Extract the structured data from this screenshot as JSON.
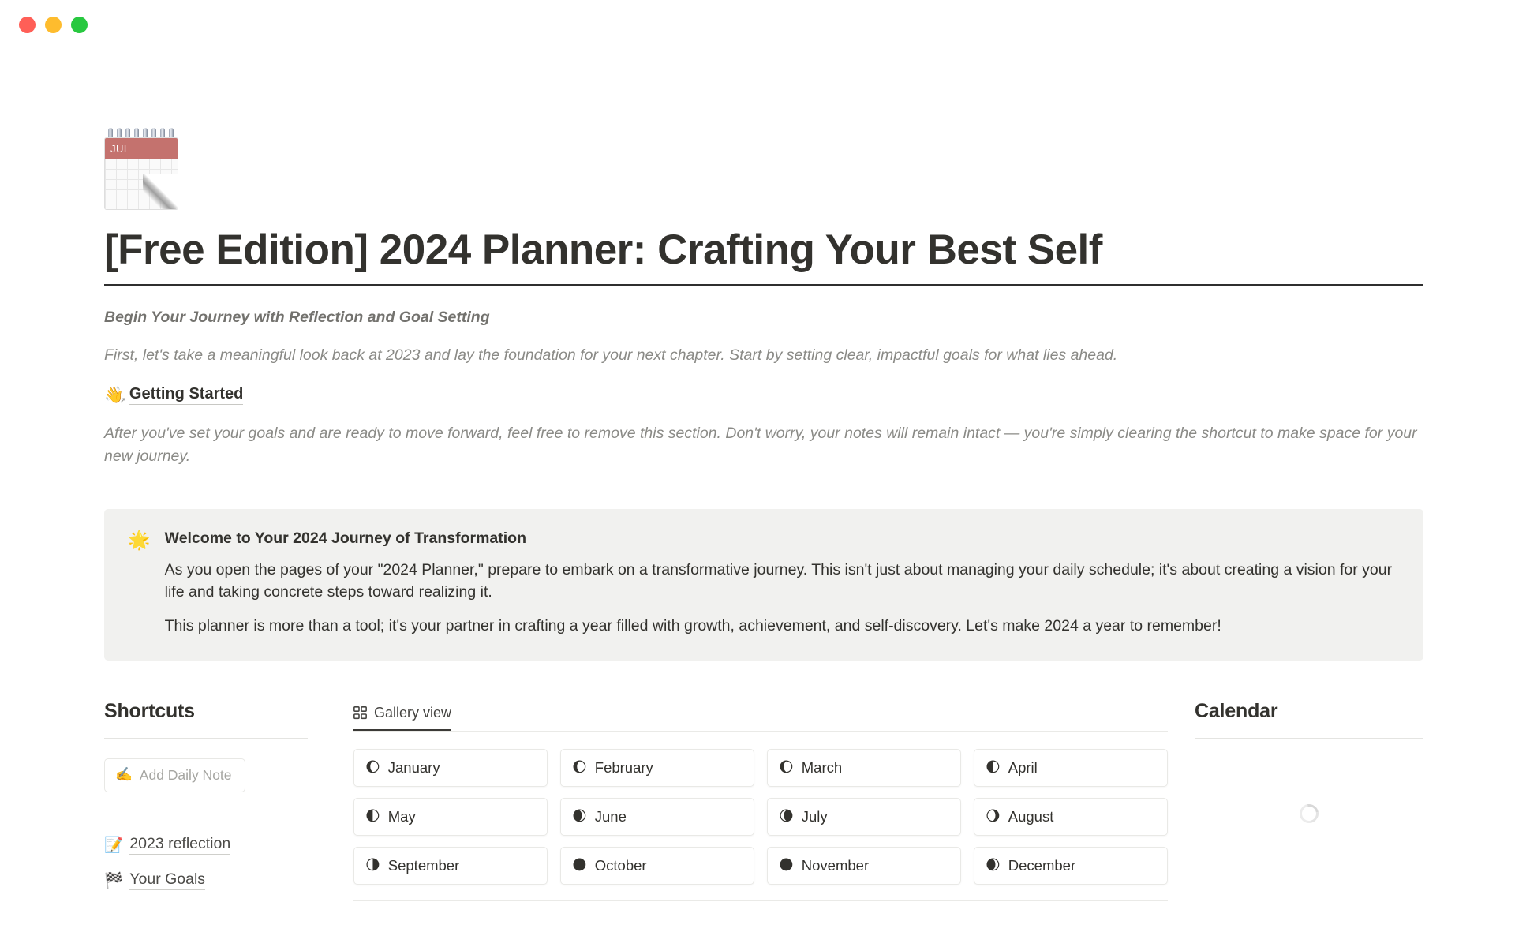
{
  "window": {
    "traffic_lights": [
      {
        "name": "close",
        "color": "#ff5f57"
      },
      {
        "name": "minimize",
        "color": "#febc2e"
      },
      {
        "name": "zoom",
        "color": "#28c840"
      }
    ]
  },
  "page": {
    "icon": "tear-off-calendar",
    "icon_month_label": "JUL",
    "title": "[Free Edition] 2024 Planner: Crafting Your Best Self",
    "subtitle": "Begin Your Journey with Reflection and Goal Setting",
    "intro_paragraph": "First, let's take a meaningful look back at 2023 and lay the foundation for your next chapter. Start by setting clear, impactful goals for what lies ahead.",
    "getting_started": {
      "emoji": "👋",
      "label": "Getting Started"
    },
    "note_paragraph": "After you've set your goals and are ready to move forward, feel free to remove this section. Don't worry, your notes will remain intact — you're simply clearing the shortcut to make space for your new journey."
  },
  "callout": {
    "emoji": "🌟",
    "background": "#f1f1ef",
    "title": "Welcome to Your 2024 Journey of Transformation",
    "paragraph_1": "As you open the pages of your \"2024 Planner,\" prepare to embark on a transformative journey. This isn't just about managing your daily schedule; it's about creating a vision for your life and taking concrete steps toward realizing it.",
    "paragraph_2": "This planner is more than a tool; it's your partner in crafting a year filled with growth, achievement, and self-discovery. Let's make 2024 a year to remember!"
  },
  "shortcuts": {
    "heading": "Shortcuts",
    "add_daily_note": {
      "emoji": "✍️",
      "label": "Add Daily Note"
    },
    "links": [
      {
        "emoji": "📝",
        "label": "2023 reflection"
      },
      {
        "emoji": "🏁",
        "label": "Your Goals"
      }
    ]
  },
  "gallery": {
    "tab": {
      "icon": "grid-view-icon",
      "label": "Gallery view",
      "active": true
    },
    "months": [
      {
        "emoji": "🌔",
        "label": "January"
      },
      {
        "emoji": "🌔",
        "label": "February"
      },
      {
        "emoji": "🌔",
        "label": "March"
      },
      {
        "emoji": "🌓",
        "label": "April"
      },
      {
        "emoji": "🌓",
        "label": "May"
      },
      {
        "emoji": "🌒",
        "label": "June"
      },
      {
        "emoji": "🌘",
        "label": "July"
      },
      {
        "emoji": "🌖",
        "label": "August"
      },
      {
        "emoji": "🌗",
        "label": "September"
      },
      {
        "emoji": "🌑",
        "label": "October"
      },
      {
        "emoji": "🌑",
        "label": "November"
      },
      {
        "emoji": "🌒",
        "label": "December"
      }
    ]
  },
  "calendar": {
    "heading": "Calendar",
    "state": "loading"
  }
}
